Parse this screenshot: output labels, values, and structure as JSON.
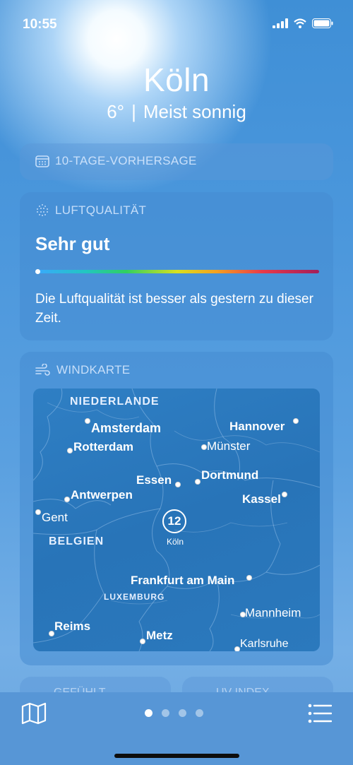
{
  "status_bar": {
    "time": "10:55"
  },
  "header": {
    "city": "Köln",
    "temperature": "6°",
    "separator": "|",
    "condition": "Meist sonnig"
  },
  "forecast_card": {
    "title": "10-TAGE-VORHERSAGE"
  },
  "air_quality_card": {
    "title": "LUFTQUALITÄT",
    "level": "Sehr gut",
    "index_fraction": 0.0,
    "description": "Die Luftqualität ist besser als gestern zu dieser Zeit."
  },
  "wind_map_card": {
    "title": "WINDKARTE",
    "labels": {
      "niederlande": "NIEDERLANDE",
      "amsterdam": "Amsterdam",
      "rotterdam": "Rotterdam",
      "hannover": "Hannover",
      "muenster": "Münster",
      "essen": "Essen",
      "dortmund": "Dortmund",
      "antwerpen": "Antwerpen",
      "kassel": "Kassel",
      "gent": "Gent",
      "belgien": "BELGIEN",
      "frankfurt": "Frankfurt am Main",
      "luxemburg": "LUXEMBURG",
      "mannheim": "Mannheim",
      "reims": "Reims",
      "metz": "Metz",
      "karlsruhe": "Karlsruhe",
      "koeln": "Köln"
    },
    "wind_speed": "12"
  },
  "peek_cards": {
    "left_title": "GEFÜHLT",
    "right_title": "UV-INDEX"
  },
  "bottom_bar": {
    "pages": 4,
    "active_page": 1
  },
  "colors": {
    "accent": "#ffffff",
    "card_bg": "#468cd2",
    "map_bg": "#2874b8"
  }
}
